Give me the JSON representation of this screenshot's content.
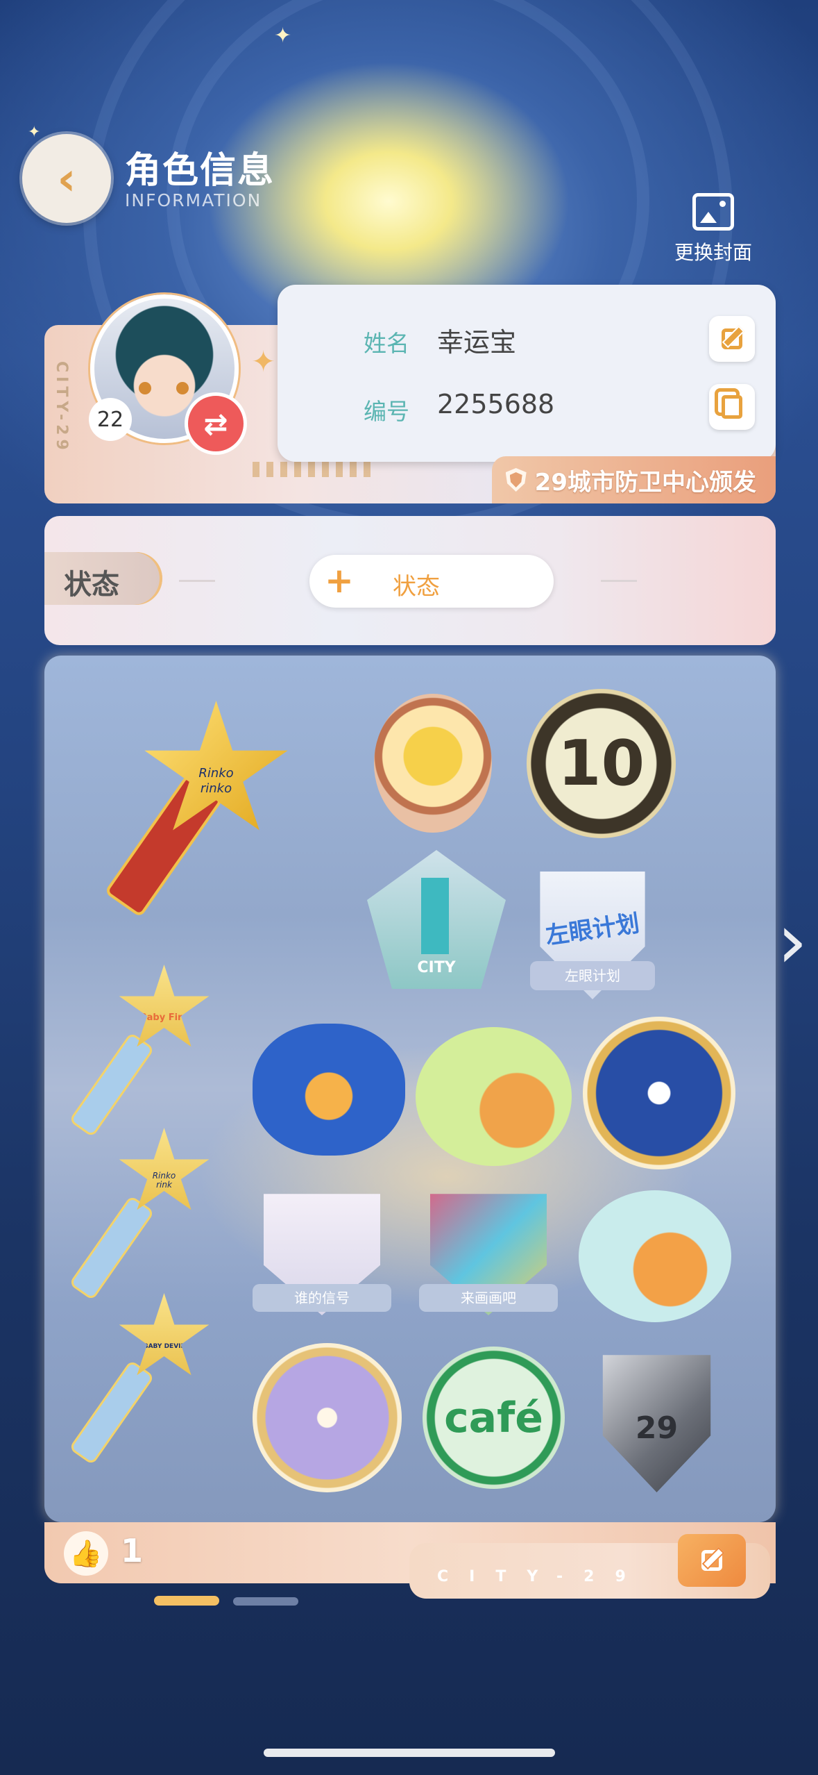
{
  "header": {
    "title": "角色信息",
    "subtitle": "INFORMATION",
    "back_icon": "back-arrow-icon",
    "change_cover_label": "更换封面"
  },
  "profile": {
    "city_tag": "CITY-29",
    "level": "22",
    "name_label": "姓名",
    "name_value": "幸运宝",
    "id_label": "编号",
    "id_value": "2255688",
    "issuer": "29城市防卫中心颁发"
  },
  "status": {
    "tag_label": "状态",
    "add_label": "状态"
  },
  "badges": {
    "star_1_lines": [
      "Rinko",
      "rinko"
    ],
    "star_2_text": "Baby Fire",
    "star_3_lines": [
      "Rinko",
      "rink"
    ],
    "star_4_text": "BABY DEVIL",
    "number_badge": "10",
    "city_badge": "CITY",
    "plan_badge_art": "左眼计划",
    "plan_badge_ribbon": "左眼计划",
    "signal_badge_ribbon": "谁的信号",
    "draw_badge_ribbon": "来画画吧",
    "cafe_badge": "café",
    "shield_badge": "29"
  },
  "footer": {
    "like_count": "1",
    "city_text": "CITY-29"
  },
  "colors": {
    "accent_orange": "#ee8a3f",
    "teal_label": "#5bb5b2",
    "gold": "#f4c063"
  }
}
